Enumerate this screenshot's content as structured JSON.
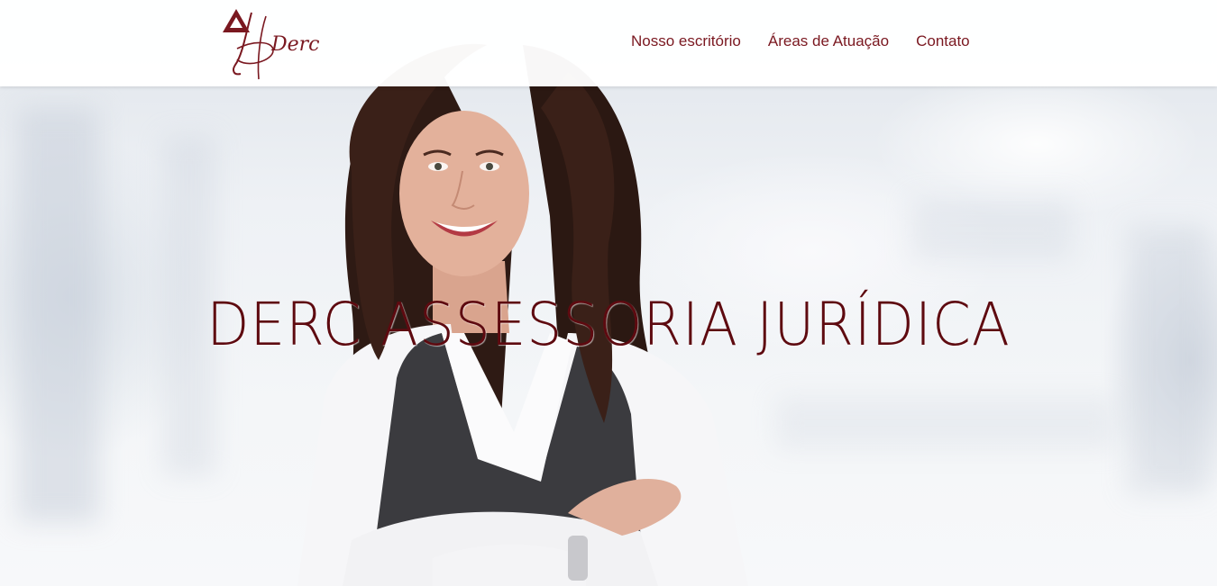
{
  "brand": {
    "logo_text": "Derc",
    "brand_color": "#7a1820"
  },
  "nav": {
    "items": [
      {
        "label": "Nosso escritório"
      },
      {
        "label": "Áreas de Atuação"
      },
      {
        "label": "Contato"
      }
    ]
  },
  "hero": {
    "title": "DERC ASSESSORIA JURÍDICA",
    "title_color": "#5e0a10"
  }
}
